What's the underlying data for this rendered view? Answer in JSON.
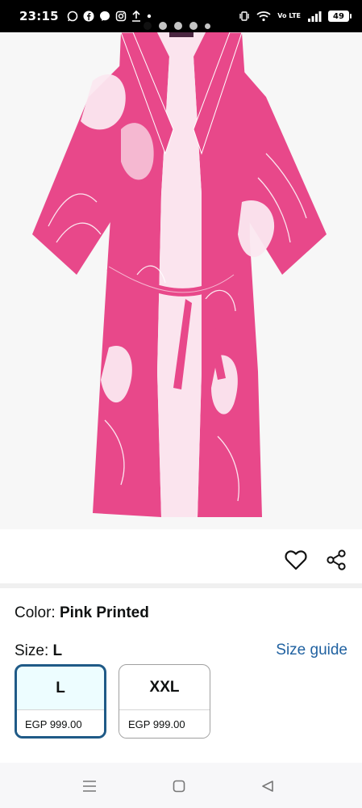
{
  "status_bar": {
    "time": "23:15",
    "left_icons": [
      "whatsapp-icon",
      "facebook-icon",
      "messenger-icon",
      "instagram-icon",
      "upload-icon",
      "dot-icon"
    ],
    "network_label": "Vo LTE",
    "battery": "49"
  },
  "product_image": {
    "colors": {
      "robe": "#e8488a",
      "pattern": "#ffffff",
      "background": "#f7f7f7"
    }
  },
  "carousel": {
    "total_dots": 5,
    "active_index": 0
  },
  "actions": {
    "wishlist_icon": "heart-outline-icon",
    "share_icon": "share-icon"
  },
  "color_selection": {
    "label": "Color:",
    "value": "Pink Printed"
  },
  "size_selection": {
    "label": "Size:",
    "value": "L",
    "guide_link": "Size guide",
    "options": [
      {
        "size": "L",
        "price": "EGP 999.00",
        "selected": true
      },
      {
        "size": "XXL",
        "price": "EGP 999.00",
        "selected": false
      }
    ]
  },
  "nav_bar": {
    "icons": [
      "menu-icon",
      "home-square-icon",
      "back-triangle-icon"
    ]
  },
  "theme": {
    "link_color": "#2162a1",
    "selected_border": "#1f5a87",
    "selected_bg": "#edfdff"
  }
}
